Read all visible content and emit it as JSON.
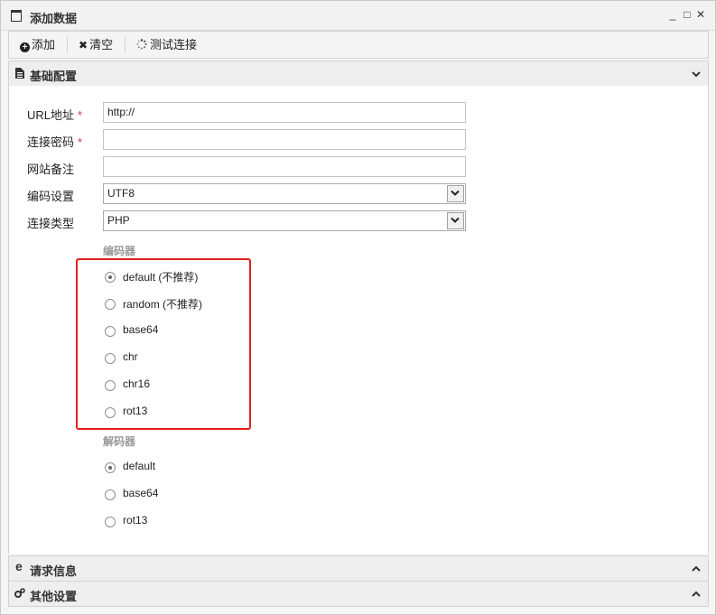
{
  "window": {
    "title": "添加数据",
    "minimize": "_",
    "maximize": "□",
    "close": "✕"
  },
  "toolbar": {
    "add_label": "添加",
    "clear_label": "清空",
    "test_label": "测试连接"
  },
  "sections": {
    "basic": {
      "title": "基础配置",
      "expanded": true
    },
    "request": {
      "title": "请求信息",
      "expanded": false
    },
    "other": {
      "title": "其他设置",
      "expanded": false
    }
  },
  "form": {
    "url": {
      "label": "URL地址",
      "required": "*",
      "value": "http://"
    },
    "password": {
      "label": "连接密码",
      "required": "*",
      "value": ""
    },
    "note": {
      "label": "网站备注",
      "value": ""
    },
    "encoding": {
      "label": "编码设置",
      "value": "UTF8"
    },
    "type": {
      "label": "连接类型",
      "value": "PHP"
    }
  },
  "encoder": {
    "title": "编码器",
    "options": [
      "default (不推荐)",
      "random (不推荐)",
      "base64",
      "chr",
      "chr16",
      "rot13"
    ],
    "selected": "default (不推荐)"
  },
  "decoder": {
    "title": "解码器",
    "options": [
      "default",
      "base64",
      "rot13"
    ],
    "selected": "default"
  },
  "colors": {
    "highlight": "#e02020",
    "required": "#dd3333"
  }
}
